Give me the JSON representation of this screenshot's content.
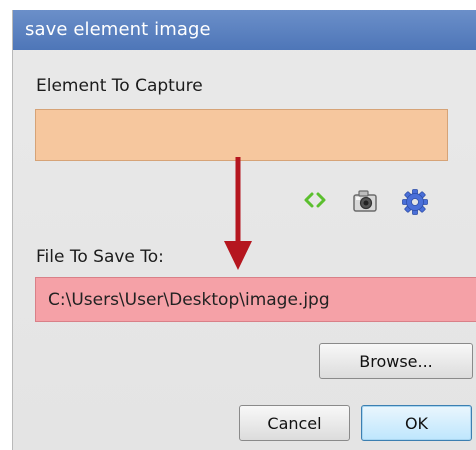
{
  "window": {
    "title": "save element image"
  },
  "capture": {
    "label": "Element To Capture",
    "value": ""
  },
  "toolbar": {
    "icons": [
      "code-brackets-icon",
      "camera-icon",
      "gear-icon"
    ]
  },
  "save": {
    "label": "File To Save To:",
    "value": "C:\\Users\\User\\Desktop\\image.jpg"
  },
  "buttons": {
    "browse": "Browse...",
    "cancel": "Cancel",
    "ok": "OK"
  },
  "colors": {
    "title_bar": "#5b80c0",
    "capture_field": "#f6c79e",
    "save_field": "#f5a1a7",
    "annotation_arrow": "#b5161f",
    "code_icon": "#5bbf2e",
    "gear_icon": "#4a6fd8"
  }
}
